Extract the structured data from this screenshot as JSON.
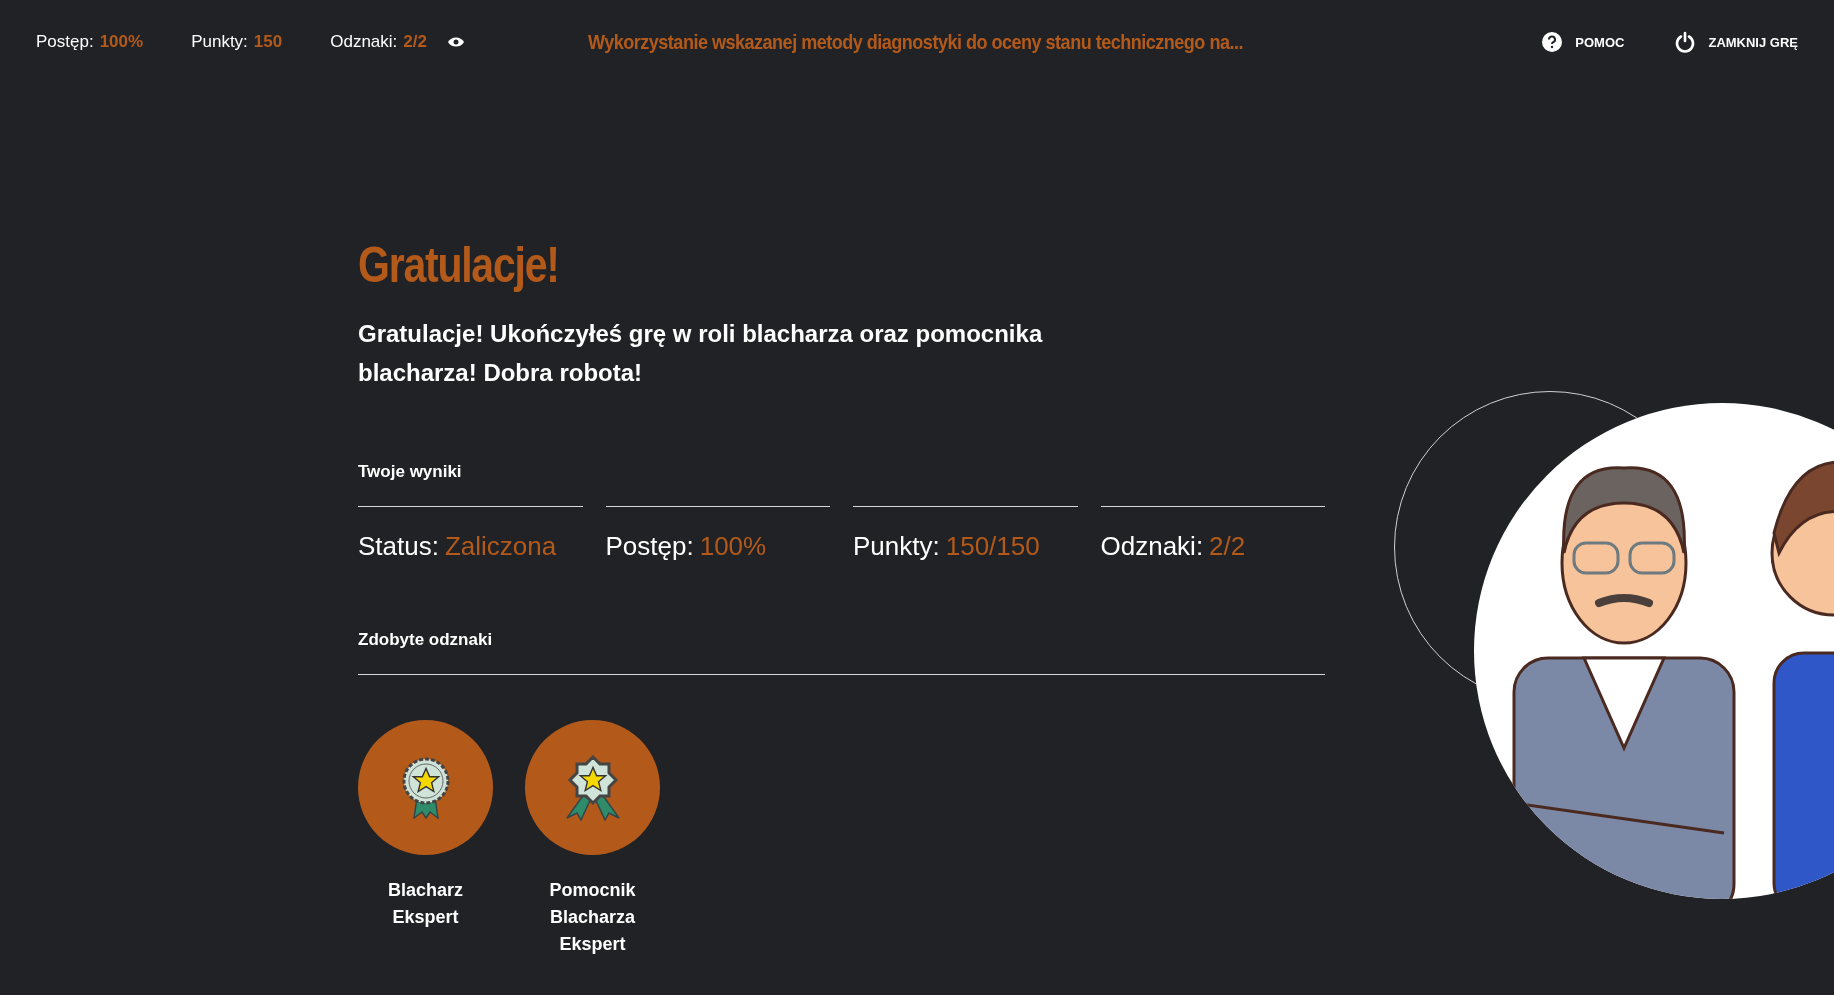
{
  "top_bar": {
    "stats": [
      {
        "label": "Postęp:",
        "value": "100%"
      },
      {
        "label": "Punkty:",
        "value": "150"
      },
      {
        "label": "Odznaki:",
        "value": "2/2"
      }
    ],
    "title": "Wykorzystanie wskazanej metody diagnostyki do oceny stanu technicznego na...",
    "actions": [
      {
        "kind": "help",
        "label": "POMOC"
      },
      {
        "kind": "close",
        "label": "ZAMKNIJ GRĘ"
      }
    ]
  },
  "heading": "Gratulacje!",
  "message": "Gratulacje! Ukończyłeś grę w roli blacharza oraz pomocnika blacharza! Dobra robota!",
  "results": {
    "title": "Twoje wyniki",
    "items": [
      {
        "label": "Status:",
        "value": "Zaliczona"
      },
      {
        "label": "Postęp:",
        "value": "100%"
      },
      {
        "label": "Punkty:",
        "value": "150/150"
      },
      {
        "label": "Odznaki:",
        "value": "2/2"
      }
    ]
  },
  "badges": {
    "title": "Zdobyte odznaki",
    "items": [
      {
        "kind": "round",
        "name": "Blacharz Ekspert"
      },
      {
        "kind": "burst",
        "name": "Pomocnik Blacharza Ekspert"
      }
    ]
  }
}
